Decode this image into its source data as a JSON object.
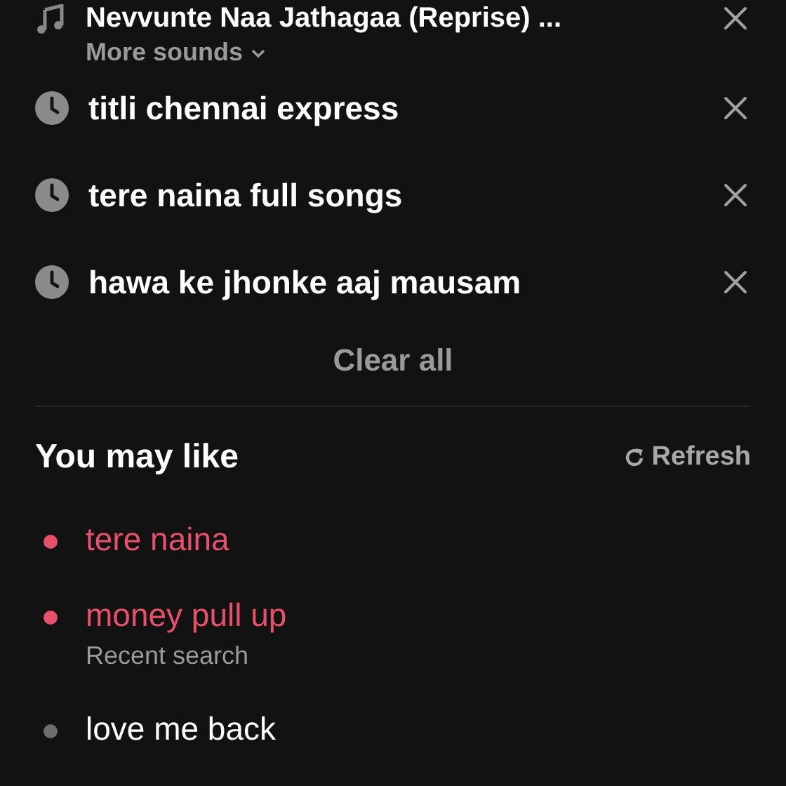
{
  "sound_item": {
    "title": "Nevvunte Naa Jathagaa (Reprise) ...",
    "more": "More sounds"
  },
  "history": [
    {
      "query": "titli chennai express"
    },
    {
      "query": "tere naina full songs"
    },
    {
      "query": "hawa ke jhonke aaj mausam"
    }
  ],
  "clear_all": "Clear all",
  "suggestions": {
    "title": "You may like",
    "refresh": "Refresh",
    "items": [
      {
        "text": "tere naina",
        "color": "#e7506b"
      },
      {
        "text": "money pull up",
        "color": "#e7506b",
        "subtitle": "Recent search"
      },
      {
        "text": "love me back",
        "color": "#6e6e6e"
      }
    ]
  }
}
